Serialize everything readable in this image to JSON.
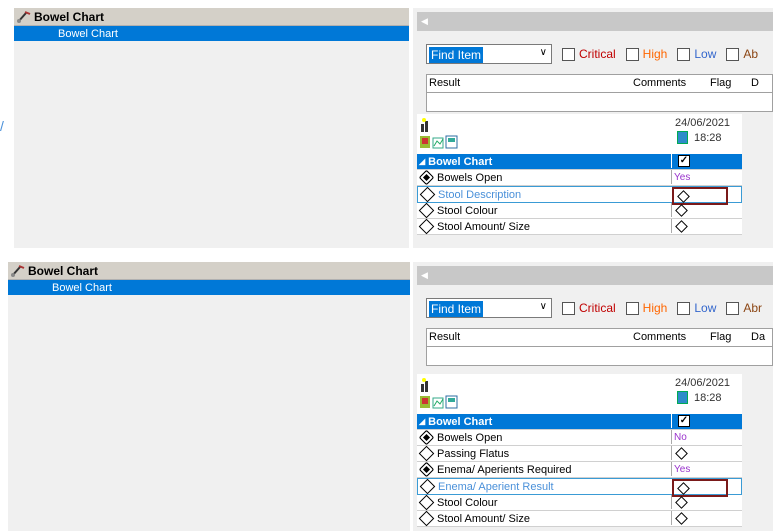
{
  "panels": [
    {
      "nav_header": "Bowel Chart",
      "nav_item": "Bowel Chart",
      "find": "Find Item",
      "filters": [
        "Critical",
        "High",
        "Low",
        "Ab"
      ],
      "result_headers": [
        "Result",
        "Comments",
        "Flag",
        "D"
      ],
      "date": "24/06/2021",
      "time": "18:28",
      "section": "Bowel Chart",
      "rows": [
        {
          "label": "Bowels Open",
          "value": "Yes",
          "filled": true,
          "highlight": false
        },
        {
          "label": "Stool Description",
          "value": "",
          "filled": false,
          "highlight": true
        },
        {
          "label": "Stool Colour",
          "value": "",
          "filled": false,
          "highlight": false
        },
        {
          "label": "Stool Amount/ Size",
          "value": "",
          "filled": false,
          "highlight": false
        }
      ]
    },
    {
      "nav_header": "Bowel Chart",
      "nav_item": "Bowel Chart",
      "find": "Find Item",
      "filters": [
        "Critical",
        "High",
        "Low",
        "Abr"
      ],
      "result_headers": [
        "Result",
        "Comments",
        "Flag",
        "Da"
      ],
      "date": "24/06/2021",
      "time": "18:28",
      "section": "Bowel Chart",
      "rows": [
        {
          "label": "Bowels Open",
          "value": "No",
          "filled": true,
          "highlight": false
        },
        {
          "label": "Passing Flatus",
          "value": "",
          "filled": false,
          "highlight": false
        },
        {
          "label": "Enema/ Aperients Required",
          "value": "Yes",
          "filled": true,
          "highlight": false
        },
        {
          "label": "Enema/ Aperient Result",
          "value": "",
          "filled": false,
          "highlight": true
        },
        {
          "label": "Stool Colour",
          "value": "",
          "filled": false,
          "highlight": false
        },
        {
          "label": "Stool Amount/ Size",
          "value": "",
          "filled": false,
          "highlight": false
        }
      ]
    }
  ]
}
